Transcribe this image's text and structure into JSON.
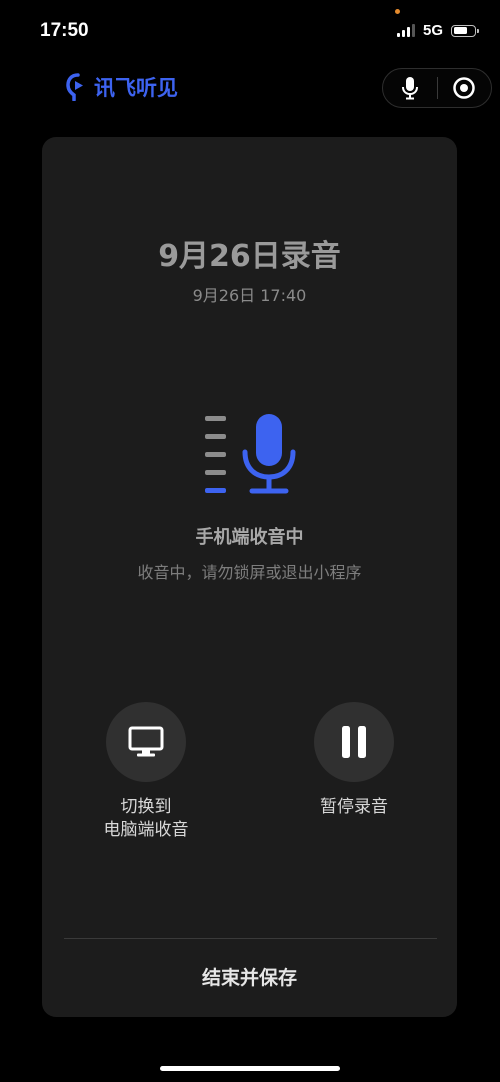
{
  "status_bar": {
    "time": "17:50",
    "network": "5G"
  },
  "header": {
    "app_name": "讯飞听见"
  },
  "recording": {
    "title": "9月26日录音",
    "datetime": "9月26日 17:40",
    "state_title": "手机端收音中",
    "state_hint": "收音中，请勿锁屏或退出小程序"
  },
  "actions": {
    "switch_line1": "切换到",
    "switch_line2": "电脑端收音",
    "pause": "暂停录音"
  },
  "footer": {
    "end_save": "结束并保存"
  },
  "colors": {
    "accent": "#3d63f0",
    "card_bg": "#1c1c1c",
    "button_bg": "#303030"
  }
}
